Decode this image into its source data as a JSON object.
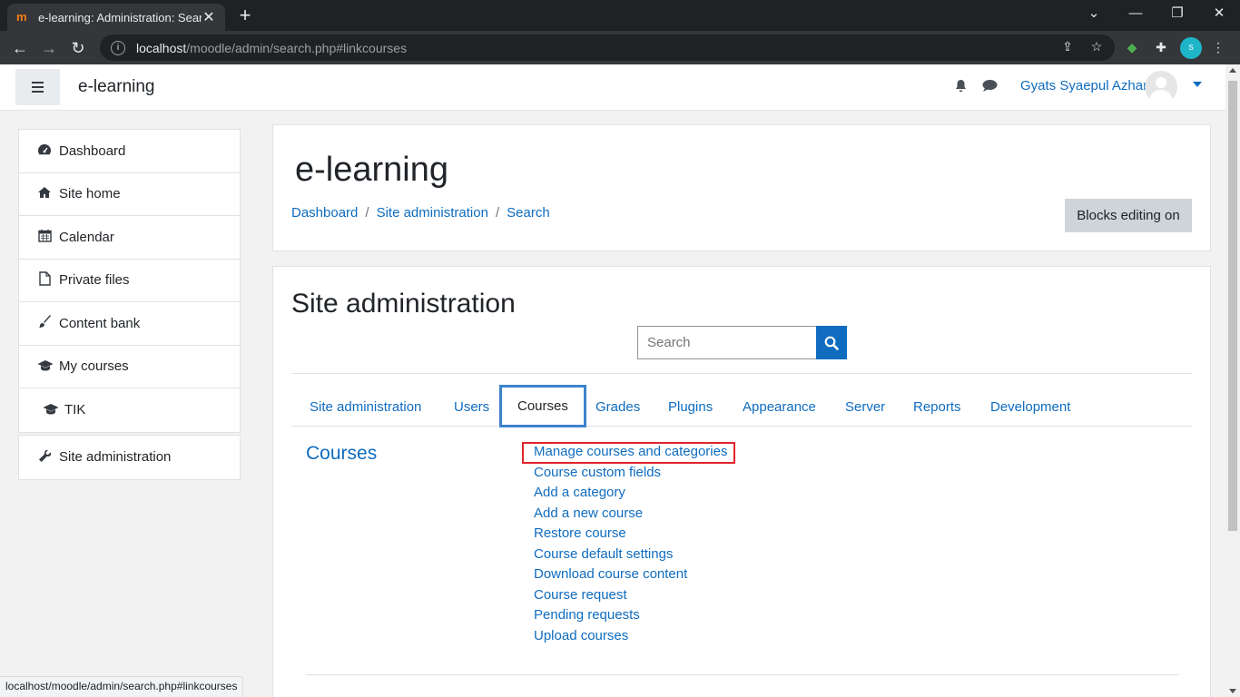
{
  "browser": {
    "tab_title": "e-learning: Administration: Search",
    "favicon": "m",
    "url_host": "localhost",
    "url_path": "/moodle/admin/search.php#linkcourses",
    "status_url": "localhost/moodle/admin/search.php#linkcourses",
    "profile_label": "S"
  },
  "navbar": {
    "brand": "e-learning",
    "username": "Gyats Syaepul Azhar",
    "accent_color": "#0f6cbf"
  },
  "sidebar": {
    "items": [
      {
        "label": "Dashboard",
        "icon": "dashboard-icon"
      },
      {
        "label": "Site home",
        "icon": "home-icon"
      },
      {
        "label": "Calendar",
        "icon": "calendar-icon"
      },
      {
        "label": "Private files",
        "icon": "file-icon"
      },
      {
        "label": "Content bank",
        "icon": "paintbrush-icon"
      },
      {
        "label": "My courses",
        "icon": "graduation-cap-icon"
      },
      {
        "label": "TIK",
        "icon": "graduation-cap-icon"
      }
    ],
    "admin_label": "Site administration"
  },
  "header": {
    "title": "e-learning",
    "breadcrumb": [
      "Dashboard",
      "Site administration",
      "Search"
    ],
    "blocks_button": "Blocks editing on"
  },
  "main": {
    "title": "Site administration",
    "search_placeholder": "Search",
    "tabs": [
      "Site administration",
      "Users",
      "Courses",
      "Grades",
      "Plugins",
      "Appearance",
      "Server",
      "Reports",
      "Development"
    ],
    "active_tab": "Courses",
    "section_title": "Courses",
    "links": [
      "Manage courses and categories",
      "Course custom fields",
      "Add a category",
      "Add a new course",
      "Restore course",
      "Course default settings",
      "Download course content",
      "Course request",
      "Pending requests",
      "Upload courses"
    ],
    "highlight_color": "#e0242b"
  }
}
